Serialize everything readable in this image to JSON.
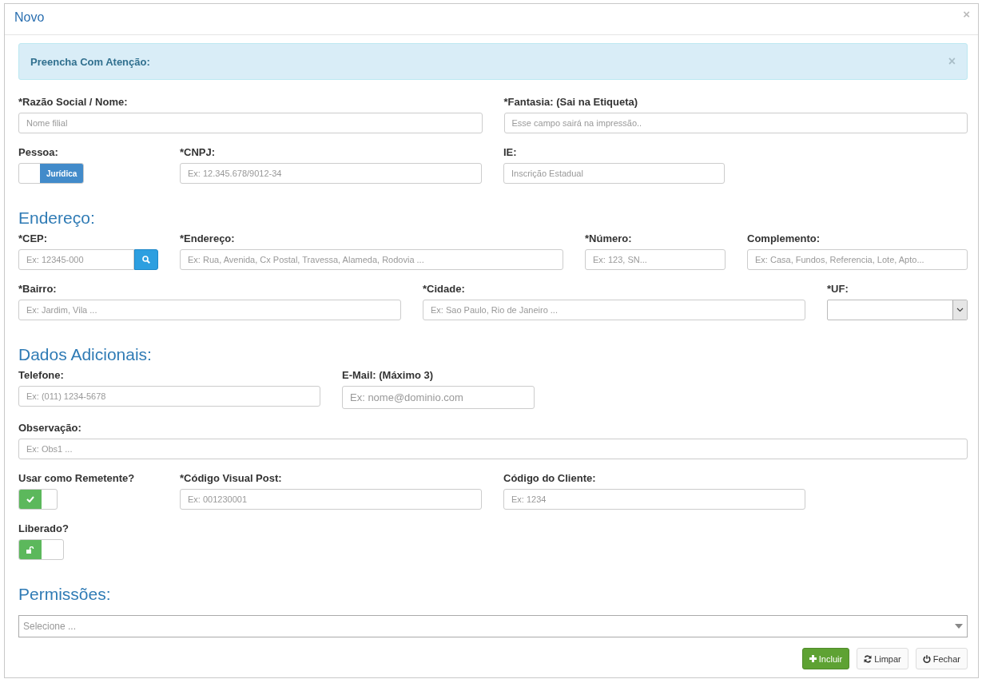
{
  "modal": {
    "title": "Novo",
    "close": "×"
  },
  "alert": {
    "text": "Preencha Com Atenção:",
    "close": "×"
  },
  "sections": [
    {
      "rows": [
        {
          "fields": [
            {
              "kind": "text",
              "label": "*Razão Social / Nome:",
              "placeholder": "Nome filial"
            },
            {
              "kind": "text",
              "label": "*Fantasia: (Sai na Etiqueta)",
              "placeholder": "Esse campo sairá na impressão.."
            }
          ]
        },
        {
          "fields": [
            {
              "kind": "switch",
              "label": "Pessoa:",
              "value": "Jurídica",
              "on": true
            },
            {
              "kind": "text",
              "label": "*CNPJ:",
              "placeholder": "Ex: 12.345.678/9012-34"
            },
            {
              "kind": "text",
              "label": "IE:",
              "placeholder": "Inscrição Estadual"
            }
          ]
        }
      ]
    },
    {
      "heading": "Endereço:",
      "rows": [
        {
          "fields": [
            {
              "kind": "search",
              "label": "*CEP:",
              "placeholder": "Ex: 12345-000"
            },
            {
              "kind": "text",
              "label": "*Endereço:",
              "placeholder": "Ex: Rua, Avenida, Cx Postal, Travessa, Alameda, Rodovia ..."
            },
            {
              "kind": "text",
              "label": "*Número:",
              "placeholder": "Ex: 123, SN..."
            },
            {
              "kind": "text",
              "label": "Complemento:",
              "placeholder": "Ex: Casa, Fundos, Referencia, Lote, Apto..."
            }
          ]
        },
        {
          "fields": [
            {
              "kind": "text",
              "label": "*Bairro:",
              "placeholder": "Ex: Jardim, Vila ..."
            },
            {
              "kind": "text",
              "label": "*Cidade:",
              "placeholder": "Ex: Sao Paulo, Rio de Janeiro ..."
            },
            {
              "kind": "select",
              "label": "*UF:"
            }
          ]
        }
      ]
    },
    {
      "heading": "Dados Adicionais:",
      "rows": [
        {
          "fields": [
            {
              "kind": "text",
              "label": "Telefone:",
              "placeholder": "Ex: (011) 1234-5678"
            },
            {
              "kind": "email",
              "label": "E-Mail: (Máximo 3)",
              "placeholder": "Ex: nome@dominio.com"
            }
          ]
        },
        {
          "fields": [
            {
              "kind": "text",
              "label": "Observação:",
              "placeholder": "Ex: Obs1 ..."
            }
          ]
        },
        {
          "fields": [
            {
              "kind": "check-toggle",
              "label": "Usar como Remetente?",
              "on": true
            },
            {
              "kind": "text",
              "label": "*Código Visual Post:",
              "placeholder": "Ex: 001230001"
            },
            {
              "kind": "text",
              "label": "Código do Cliente:",
              "placeholder": "Ex: 1234"
            }
          ]
        },
        {
          "fields": [
            {
              "kind": "lock-toggle",
              "label": "Liberado?",
              "on": true
            }
          ]
        }
      ]
    },
    {
      "heading": "Permissões:",
      "rows": [
        {
          "fields": [
            {
              "kind": "multiselect",
              "placeholder": "Selecione ..."
            }
          ]
        }
      ]
    }
  ],
  "buttons": [
    {
      "kind": "add",
      "label": "Incluir"
    },
    {
      "kind": "reset",
      "label": "Limpar"
    },
    {
      "kind": "close",
      "label": "Fechar"
    }
  ]
}
